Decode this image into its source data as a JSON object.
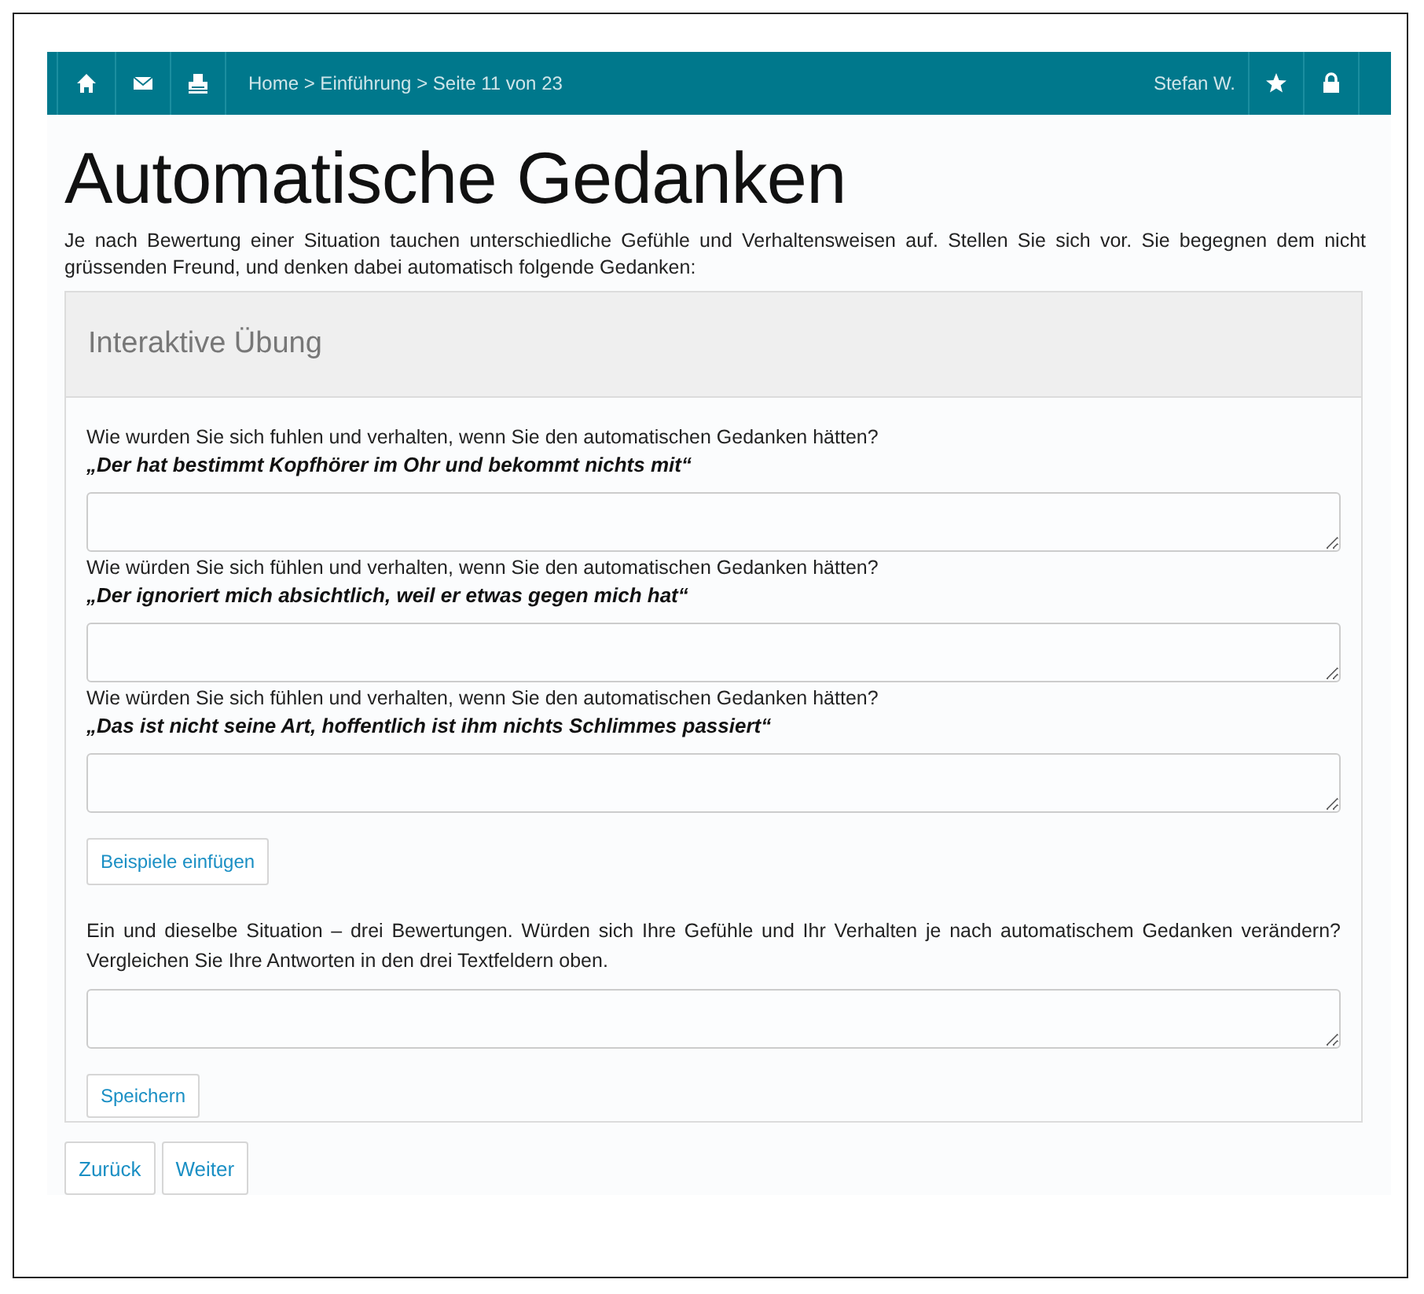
{
  "navbar": {
    "left_icons": [
      {
        "kind": "home"
      },
      {
        "kind": "mail"
      },
      {
        "kind": "print"
      }
    ],
    "breadcrumb": "Home > Einführung > Seite 11 von 23",
    "user": "Stefan W.",
    "right_icons": [
      {
        "kind": "star"
      },
      {
        "kind": "lock"
      }
    ]
  },
  "title": "Automatische Gedanken",
  "intro": "Je nach Bewertung einer Situation tauchen unterschiedliche Gefühle und Verhaltensweisen auf. Stellen Sie sich vor. Sie begegnen dem nicht grüssenden Freund, und denken dabei automatisch folgende Gedanken:",
  "panel": {
    "heading": "Interaktive Übung",
    "questions": [
      {
        "prompt": "Wie wurden Sie sich fuhlen und verhalten, wenn Sie den automatischen Gedanken hätten?",
        "thought": "„Der hat bestimmt Kopfhörer im Ohr und bekommt nichts mit“"
      },
      {
        "prompt": "Wie würden Sie sich fühlen und verhalten, wenn Sie den automatischen Gedanken hätten?",
        "thought": "„Der ignoriert mich absichtlich, weil er etwas gegen mich hat“"
      },
      {
        "prompt": "Wie würden Sie sich fühlen und verhalten, wenn Sie den automatischen Gedanken hätten?",
        "thought": "„Das ist nicht seine Art, hoffentlich ist ihm nichts Schlimmes passiert“"
      }
    ],
    "insert_button": "Beispiele einfügen",
    "reflection": "Ein und dieselbe Situation – drei Bewertungen. Würden sich Ihre Gefühle und Ihr Verhalten je nach automatischem Gedanken verändern? Vergleichen Sie Ihre Antworten in den drei Textfeldern oben.",
    "save_button": "Speichern"
  },
  "nav_buttons": [
    "Zurück",
    "Weiter"
  ]
}
